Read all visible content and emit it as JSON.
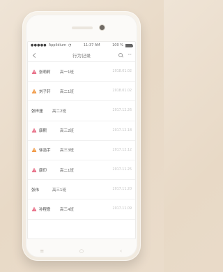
{
  "statusbar": {
    "carrier": "Applidium",
    "time": "11:37 AM",
    "battery": "100 %",
    "battery_level": 1
  },
  "navbar": {
    "title": "行为记录",
    "back_icon": "chevron-left-icon",
    "search_icon": "search-icon",
    "more_icon": "more-icon"
  },
  "records": [
    {
      "name": "张莉莉",
      "class": "高一1班",
      "date": "2018.01.02",
      "icon": "warning-icon",
      "icon_color": "#e55a76",
      "has_icon": true
    },
    {
      "name": "刘子轩",
      "class": "高二1班",
      "date": "2018.01.02",
      "icon": "warning-icon",
      "icon_color": "#ef8c2d",
      "has_icon": true
    },
    {
      "name": "张梓潼",
      "class": "高二2班",
      "date": "2017.12.26",
      "icon": "",
      "icon_color": "",
      "has_icon": false
    },
    {
      "name": "康熙",
      "class": "高三2班",
      "date": "2017.12.18",
      "icon": "warning-icon",
      "icon_color": "#e55a76",
      "has_icon": true
    },
    {
      "name": "徐浩宇",
      "class": "高三3班",
      "date": "2017.12.12",
      "icon": "warning-icon",
      "icon_color": "#ef8c2d",
      "has_icon": true
    },
    {
      "name": "康印",
      "class": "高二1班",
      "date": "2017.11.25",
      "icon": "warning-icon",
      "icon_color": "#e55a76",
      "has_icon": true
    },
    {
      "name": "张伟",
      "class": "高三1班",
      "date": "2017.11.20",
      "icon": "",
      "icon_color": "",
      "has_icon": false
    },
    {
      "name": "孙程意",
      "class": "高三4班",
      "date": "2017.11.09",
      "icon": "warning-icon",
      "icon_color": "#e55a76",
      "has_icon": true
    }
  ],
  "hardware": {
    "menu_icon": "menu-icon",
    "home_icon": "home-icon",
    "back_icon": "back-icon"
  }
}
